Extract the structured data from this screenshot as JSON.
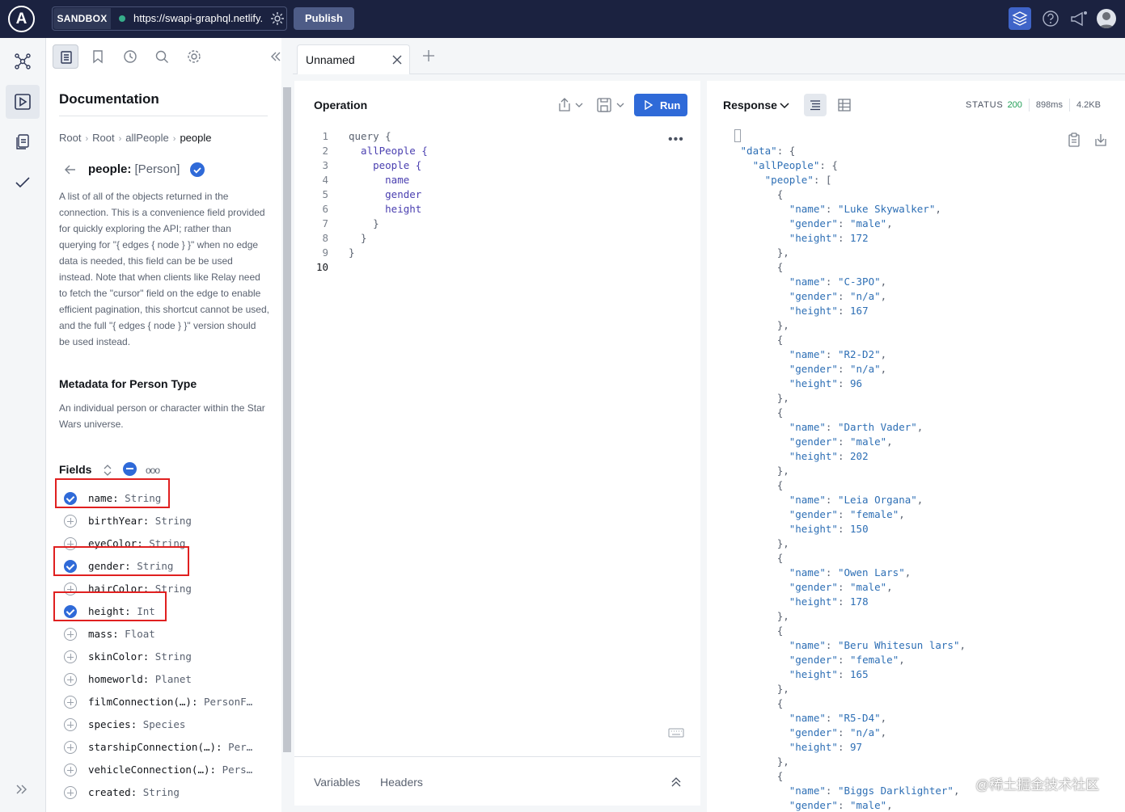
{
  "topbar": {
    "logo": "A",
    "sandbox_label": "SANDBOX",
    "url": "https://swapi-graphql.netlify.app/.netlify/functions/index",
    "publish_label": "Publish",
    "status_color": "#36ad8a"
  },
  "rail": {
    "items": [
      "schema-icon",
      "explorer-icon",
      "collection-icon",
      "checks-icon"
    ],
    "active": "explorer-icon"
  },
  "doc": {
    "title": "Documentation",
    "breadcrumb": [
      "Root",
      "Root",
      "allPeople",
      "people"
    ],
    "field_name": "people:",
    "field_type": "[Person]",
    "description": "A list of all of the objects returned in the connection. This is a convenience field provided for quickly exploring the API; rather than querying for \"{ edges { node } }\" when no edge data is needed, this field can be be used instead. Note that when clients like Relay need to fetch the \"cursor\" field on the edge to enable efficient pagination, this shortcut cannot be used, and the full \"{ edges { node } }\" version should be used instead.",
    "meta_title": "Metadata for Person Type",
    "meta_desc": "An individual person or character within the Star Wars universe.",
    "fields_label": "Fields",
    "fields": [
      {
        "name": "name",
        "type": "String",
        "selected": true
      },
      {
        "name": "birthYear",
        "type": "String",
        "selected": false
      },
      {
        "name": "eyeColor",
        "type": "String",
        "selected": false
      },
      {
        "name": "gender",
        "type": "String",
        "selected": true
      },
      {
        "name": "hairColor",
        "type": "String",
        "selected": false
      },
      {
        "name": "height",
        "type": "Int",
        "selected": true
      },
      {
        "name": "mass",
        "type": "Float",
        "selected": false
      },
      {
        "name": "skinColor",
        "type": "String",
        "selected": false
      },
      {
        "name": "homeworld",
        "type": "Planet",
        "selected": false
      },
      {
        "name": "filmConnection(…)",
        "type": "PersonF…",
        "selected": false
      },
      {
        "name": "species",
        "type": "Species",
        "selected": false
      },
      {
        "name": "starshipConnection(…)",
        "type": "Per…",
        "selected": false
      },
      {
        "name": "vehicleConnection(…)",
        "type": "Pers…",
        "selected": false
      },
      {
        "name": "created",
        "type": "String",
        "selected": false
      }
    ]
  },
  "tabs": [
    {
      "label": "Unnamed"
    }
  ],
  "operation": {
    "title": "Operation",
    "run_label": "Run",
    "line_numbers": [
      "1",
      "2",
      "3",
      "4",
      "5",
      "6",
      "7",
      "8",
      "9",
      "10"
    ],
    "code": [
      "query {",
      "  allPeople {",
      "    people {",
      "      name",
      "      gender",
      "      height",
      "    }",
      "  }",
      "}",
      ""
    ],
    "footer_variables": "Variables",
    "footer_headers": "Headers"
  },
  "response": {
    "title": "Response",
    "status_label": "STATUS",
    "status_code": "200",
    "time": "898ms",
    "size": "4.2KB",
    "people": [
      {
        "name": "Luke Skywalker",
        "gender": "male",
        "height": "172"
      },
      {
        "name": "C-3PO",
        "gender": "n/a",
        "height": "167"
      },
      {
        "name": "R2-D2",
        "gender": "n/a",
        "height": "96"
      },
      {
        "name": "Darth Vader",
        "gender": "male",
        "height": "202"
      },
      {
        "name": "Leia Organa",
        "gender": "female",
        "height": "150"
      },
      {
        "name": "Owen Lars",
        "gender": "male",
        "height": "178"
      },
      {
        "name": "Beru Whitesun lars",
        "gender": "female",
        "height": "165"
      },
      {
        "name": "R5-D4",
        "gender": "n/a",
        "height": "97"
      },
      {
        "name": "Biggs Darklighter",
        "gender": "male",
        "height": ""
      }
    ]
  },
  "watermark": "@稀土掘金技术社区"
}
